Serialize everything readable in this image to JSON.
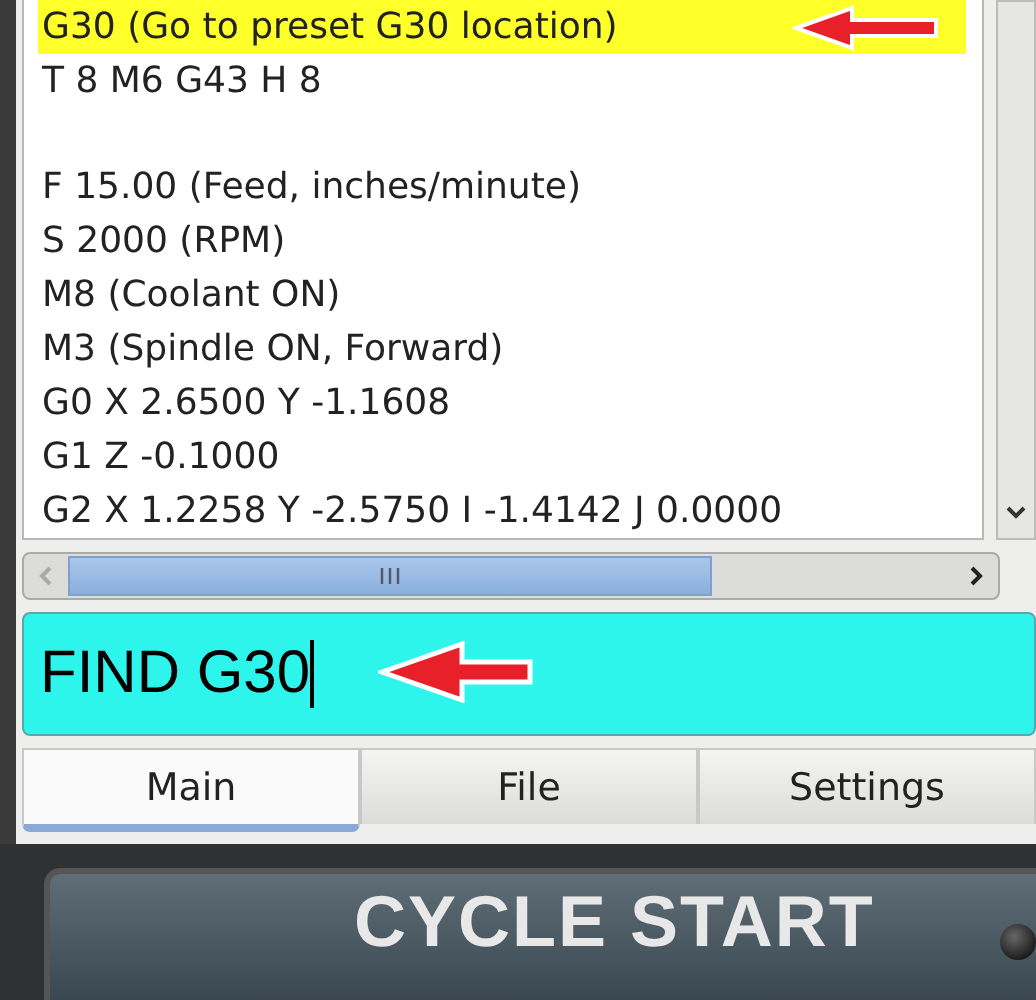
{
  "program_lines": [
    {
      "kind": "code",
      "text": "G30 (Go to preset G30 location)",
      "selected": true
    },
    {
      "kind": "code",
      "text": "T 8 M6 G43 H 8",
      "selected": false
    },
    {
      "kind": "blank"
    },
    {
      "kind": "code",
      "text": "F 15.00 (Feed, inches/minute)",
      "selected": false
    },
    {
      "kind": "code",
      "text": "S 2000 (RPM)",
      "selected": false
    },
    {
      "kind": "code",
      "text": "M8 (Coolant ON)",
      "selected": false
    },
    {
      "kind": "code",
      "text": "M3 (Spindle ON, Forward)",
      "selected": false
    },
    {
      "kind": "code",
      "text": "G0 X 2.6500 Y -1.1608",
      "selected": false
    },
    {
      "kind": "code",
      "text": "G1 Z -0.1000",
      "selected": false
    },
    {
      "kind": "code",
      "text": "G2 X 1.2258 Y -2.5750 I -1.4142 J 0.0000",
      "selected": false
    }
  ],
  "command_field": {
    "value": "FIND G30"
  },
  "tabs": [
    {
      "label": "Main",
      "selected": true
    },
    {
      "label": "File",
      "selected": false
    },
    {
      "label": "Settings",
      "selected": false
    }
  ],
  "cycle_start_button": {
    "label": "CYCLE START"
  }
}
